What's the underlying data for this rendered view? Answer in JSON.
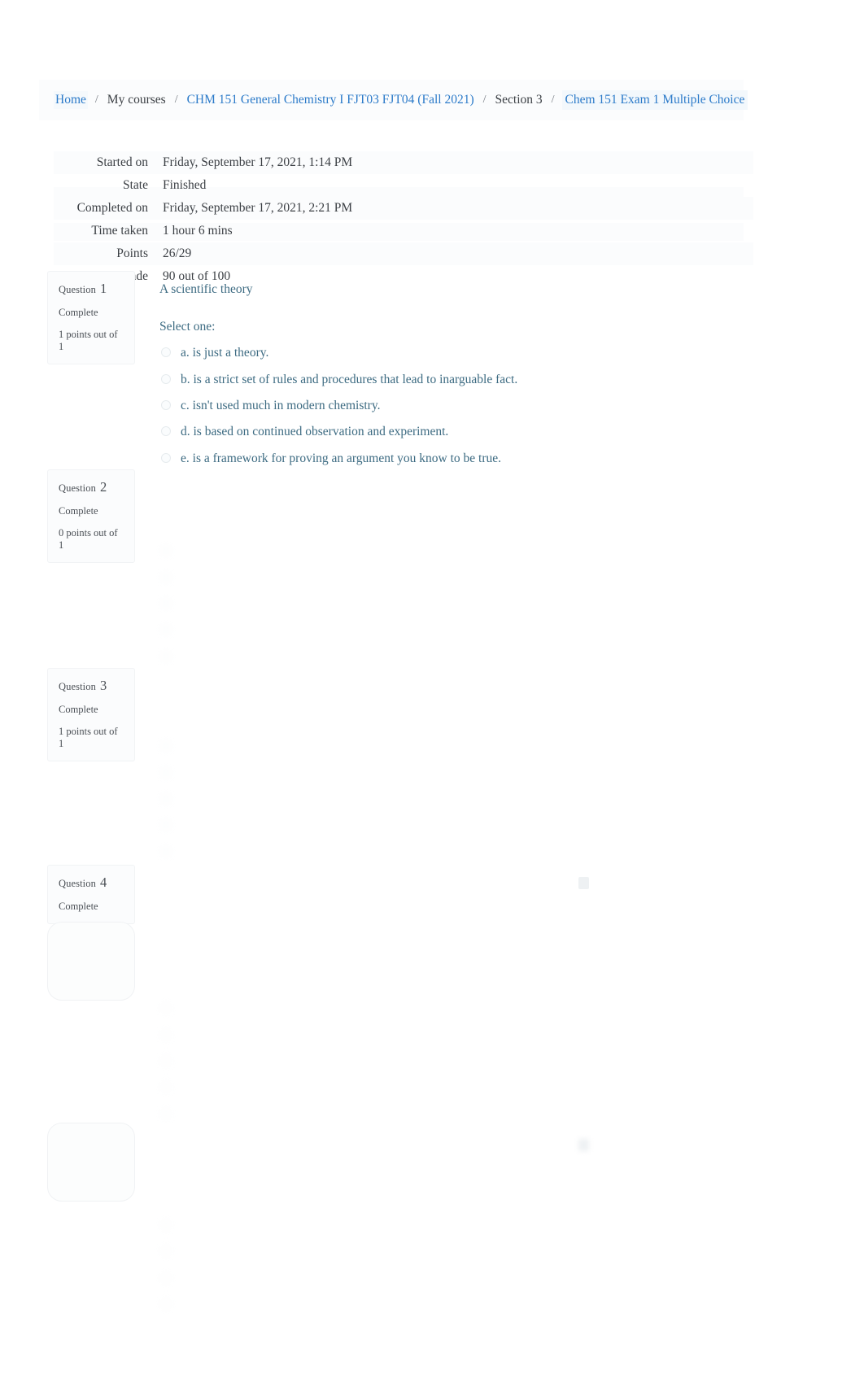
{
  "breadcrumb": {
    "items": [
      {
        "label": "Home",
        "kind": "link"
      },
      {
        "label": "My courses",
        "kind": "plain"
      },
      {
        "label": "CHM 151 General Chemistry I FJT03 FJT04 (Fall 2021)",
        "kind": "link"
      },
      {
        "label": "Section 3",
        "kind": "plain"
      },
      {
        "label": "Chem 151 Exam 1 Multiple Choice",
        "kind": "current"
      }
    ],
    "separator": "/"
  },
  "summary": {
    "rows": [
      {
        "label": "Started on",
        "value": "Friday, September 17, 2021, 1:14 PM"
      },
      {
        "label": "State",
        "value": "Finished"
      },
      {
        "label": "Completed on",
        "value": "Friday, September 17, 2021, 2:21 PM"
      },
      {
        "label": "Time taken",
        "value": "1 hour 6 mins"
      },
      {
        "label": "Points",
        "value": "26/29"
      },
      {
        "label": "Grade",
        "value": "90  out of 100"
      }
    ]
  },
  "questions": [
    {
      "number_label": "Question",
      "number": "1",
      "state": "Complete",
      "mark": "1 points out of 1",
      "text": "A scientific theory",
      "select_prompt": "Select one:",
      "options": [
        {
          "letter": "a.",
          "text": "is just a theory."
        },
        {
          "letter": "b.",
          "text": "is a strict set of rules and procedures that lead to inarguable fact."
        },
        {
          "letter": "c.",
          "text": "isn't used much in modern chemistry."
        },
        {
          "letter": "d.",
          "text": "is based on continued observation and experiment."
        },
        {
          "letter": "e.",
          "text": "is a framework for proving an argument you know to be true."
        }
      ]
    },
    {
      "number_label": "Question",
      "number": "2",
      "state": "Complete",
      "mark": "0 points out of 1"
    },
    {
      "number_label": "Question",
      "number": "3",
      "state": "Complete",
      "mark": "1 points out of 1"
    },
    {
      "number_label": "Question",
      "number": "4",
      "state": "Complete",
      "mark": ""
    }
  ],
  "colors": {
    "link": "#2b7ac9",
    "question_text": "#3d6b82",
    "body_text": "#3b3f44",
    "panel": "#fbfcfd",
    "page_background": "#ffffff"
  }
}
